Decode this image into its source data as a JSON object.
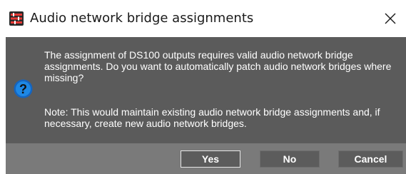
{
  "dialog": {
    "title": "Audio network bridge assignments",
    "icons": {
      "app": "app-icon",
      "close": "close-icon",
      "question": "question-icon"
    },
    "message": "The assignment of DS100 outputs requires valid audio network bridge assignments. Do you want to automatically patch audio network bridges where missing?",
    "note": "Note: This would maintain existing audio network bridge assignments and, if necessary, create new audio network bridges.",
    "buttons": {
      "yes": "Yes",
      "no": "No",
      "cancel": "Cancel"
    }
  },
  "colors": {
    "body_background": "#5b5b5b",
    "button_bar_background": "#7a7a7a",
    "button_background": "#5c5c5c",
    "question_icon": "#1565c0",
    "app_icon": "#d32f2f"
  }
}
